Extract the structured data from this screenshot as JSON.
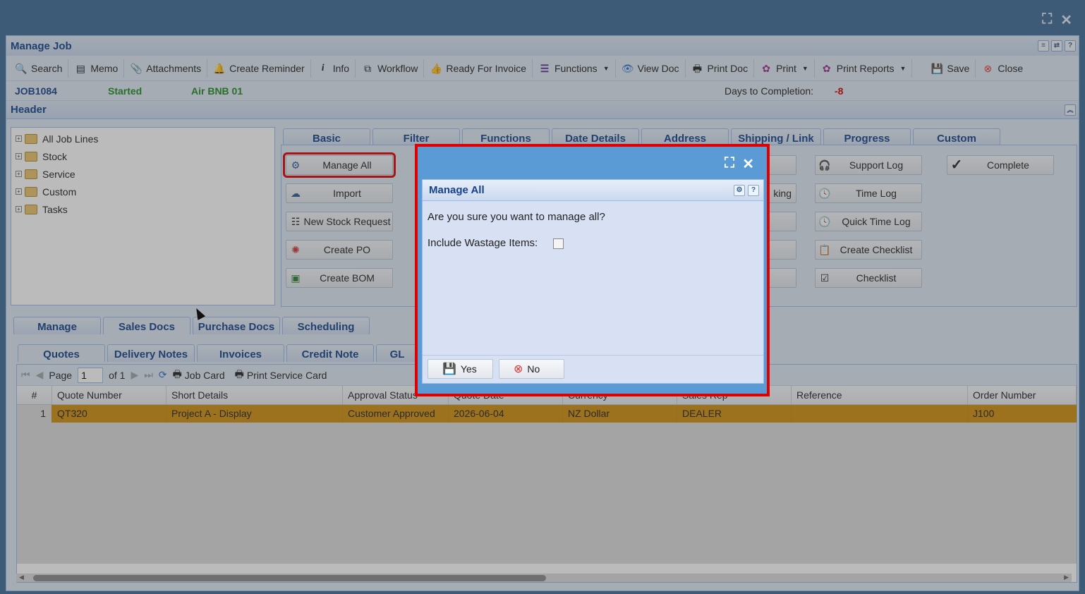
{
  "window": {
    "title": "Manage Job"
  },
  "toolbar": [
    {
      "label": "Search",
      "icon": "search-icon"
    },
    {
      "label": "Memo",
      "icon": "memo-icon"
    },
    {
      "label": "Attachments",
      "icon": "paperclip-icon"
    },
    {
      "label": "Create Reminder",
      "icon": "bell-icon"
    },
    {
      "label": "Info",
      "icon": "info-icon"
    },
    {
      "label": "Workflow",
      "icon": "workflow-icon"
    },
    {
      "label": "Ready For Invoice",
      "icon": "thumbs-up-icon"
    },
    {
      "label": "Functions",
      "icon": "hamburger-icon"
    },
    {
      "label": "View Doc",
      "icon": "eye-icon"
    },
    {
      "label": "Print Doc",
      "icon": "printer-icon"
    },
    {
      "label": "Print",
      "icon": "print-gear-icon"
    },
    {
      "label": "Print Reports",
      "icon": "print-gear-icon"
    },
    {
      "label": "Save",
      "icon": "floppy-icon"
    },
    {
      "label": "Close",
      "icon": "close-circle-icon"
    }
  ],
  "status": {
    "job": "JOB1084",
    "state": "Started",
    "name": "Air BNB 01",
    "days_label": "Days to Completion:",
    "days_value": "-8"
  },
  "header_panel": {
    "title": "Header"
  },
  "tree": [
    "All Job Lines",
    "Stock",
    "Service",
    "Custom",
    "Tasks"
  ],
  "top_tabs": [
    "Basic",
    "Filter",
    "Functions",
    "Date Details",
    "Address",
    "Shipping / Link",
    "Progress",
    "Custom"
  ],
  "func_col1": [
    "Manage All",
    "Import",
    "New Stock Request",
    "Create PO",
    "Create BOM"
  ],
  "func_col_mid": [
    "",
    "king",
    "",
    "",
    "",
    ""
  ],
  "func_col3": [
    "Support Log",
    "Time Log",
    "Quick Time Log",
    "Create Checklist",
    "Checklist"
  ],
  "func_col4": [
    "Complete"
  ],
  "lower_tabs": [
    "Manage",
    "Sales Docs",
    "Purchase Docs",
    "Scheduling"
  ],
  "sub_tabs": [
    "Quotes",
    "Delivery Notes",
    "Invoices",
    "Credit Note",
    "GL"
  ],
  "pager": {
    "page_label": "Page",
    "page_value": "1",
    "of_label": "of 1",
    "job_card": "Job Card",
    "print_service": "Print Service Card"
  },
  "grid": {
    "columns": [
      "#",
      "Quote Number",
      "Short Details",
      "Approval Status",
      "Quote Date",
      "Currency",
      "Sales Rep",
      "Reference",
      "Order Number"
    ],
    "rows": [
      [
        "1",
        "QT320",
        "Project A - Display",
        "Customer Approved",
        "2026-06-04",
        "NZ Dollar",
        "DEALER",
        "",
        "J100"
      ]
    ]
  },
  "dialog": {
    "title": "Manage All",
    "question": "Are you sure you want to manage all?",
    "checkbox_label": "Include Wastage Items:",
    "yes": "Yes",
    "no": "No"
  },
  "colors": {
    "accent": "#15428b",
    "highlight": "#e00000",
    "row_selected": "#d28f10",
    "status_green": "#1f8a1f",
    "days_red": "#d00000"
  }
}
